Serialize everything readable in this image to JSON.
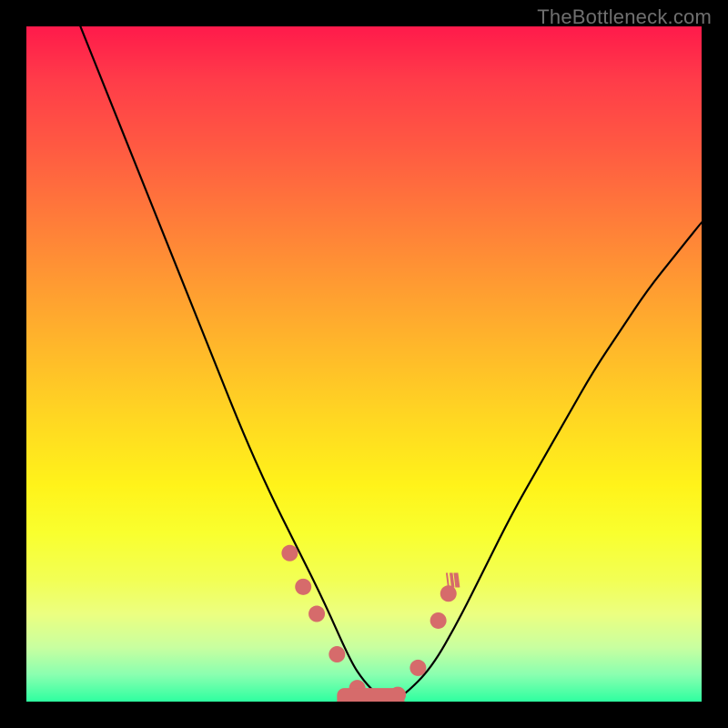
{
  "watermark": "TheBottleneck.com",
  "chart_data": {
    "type": "line",
    "title": "",
    "xlabel": "",
    "ylabel": "",
    "xlim": [
      0,
      100
    ],
    "ylim": [
      0,
      100
    ],
    "series": [
      {
        "name": "curve",
        "x": [
          8,
          12,
          16,
          20,
          24,
          28,
          32,
          36,
          40,
          44,
          48,
          50,
          52,
          54,
          56,
          60,
          64,
          68,
          72,
          76,
          80,
          84,
          88,
          92,
          96,
          100
        ],
        "y": [
          100,
          90,
          80,
          70,
          60,
          50,
          40,
          31,
          23,
          15,
          6,
          3,
          1,
          0,
          1,
          5,
          12,
          20,
          28,
          35,
          42,
          49,
          55,
          61,
          66,
          71
        ]
      }
    ],
    "markers": {
      "color": "#d66b6b",
      "points_x": [
        39,
        41,
        43,
        46,
        49,
        52,
        55,
        58,
        61,
        62.5
      ],
      "points_y": [
        22,
        17,
        13,
        7,
        2,
        0,
        1,
        5,
        12,
        16
      ]
    },
    "plateau_bar": {
      "color": "#d66b6b",
      "x_start": 46,
      "x_end": 56,
      "y": 0,
      "height": 2
    }
  }
}
